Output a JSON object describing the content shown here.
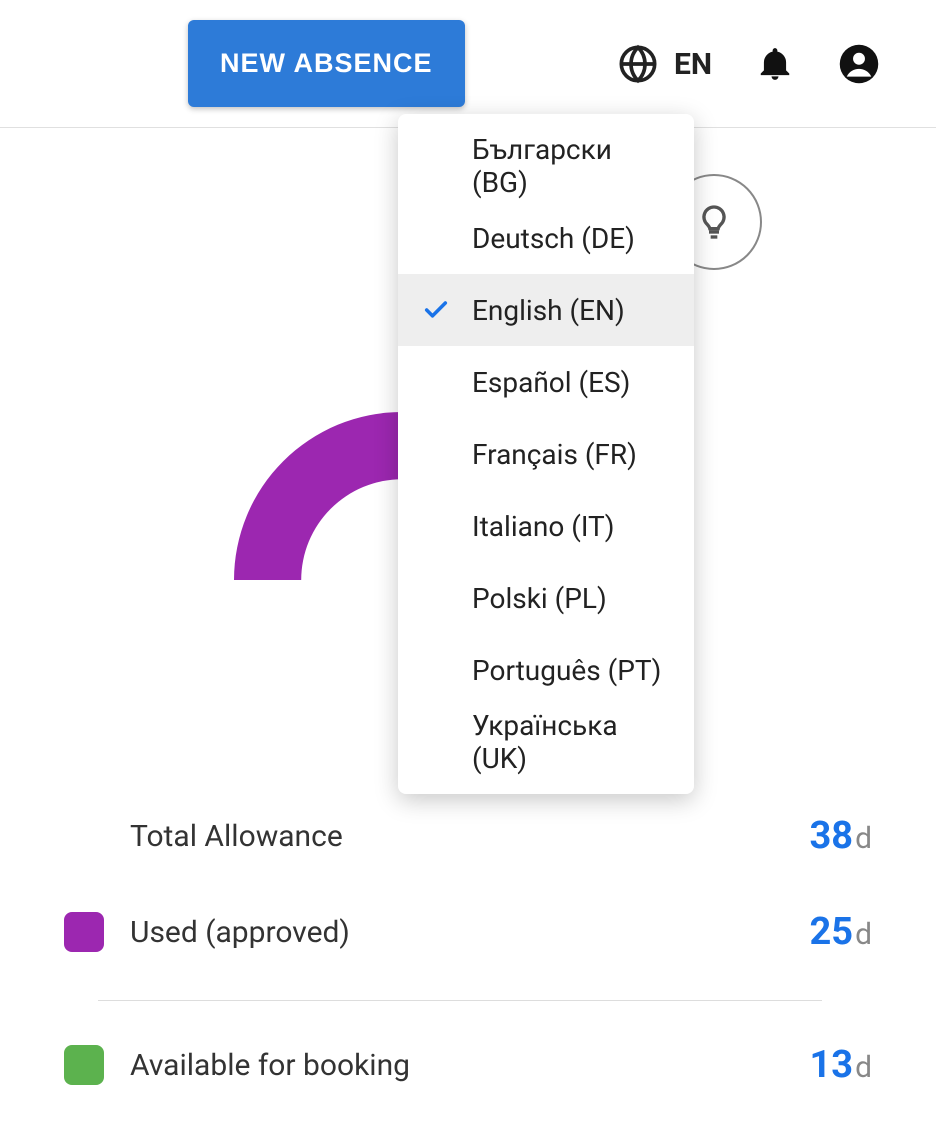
{
  "header": {
    "new_absence_label": "NEW ABSENCE",
    "lang_code": "EN"
  },
  "language_menu": {
    "items": [
      {
        "label": "Български (BG)",
        "selected": false
      },
      {
        "label": "Deutsch (DE)",
        "selected": false
      },
      {
        "label": "English (EN)",
        "selected": true
      },
      {
        "label": "Español (ES)",
        "selected": false
      },
      {
        "label": "Français (FR)",
        "selected": false
      },
      {
        "label": "Italiano (IT)",
        "selected": false
      },
      {
        "label": "Polski (PL)",
        "selected": false
      },
      {
        "label": "Português (PT)",
        "selected": false
      },
      {
        "label": "Українська (UK)",
        "selected": false
      }
    ]
  },
  "stats": {
    "unit": "d",
    "total_allowance": {
      "label": "Total Allowance",
      "value": "38"
    },
    "used_approved": {
      "label": "Used (approved)",
      "value": "25",
      "color": "#9c27b0"
    },
    "available": {
      "label": "Available for booking",
      "value": "13",
      "color": "#5cb24e"
    }
  },
  "colors": {
    "primary_button": "#2d7bd8",
    "accent_blue": "#1a73e8",
    "donut_purple": "#9c27b0"
  }
}
